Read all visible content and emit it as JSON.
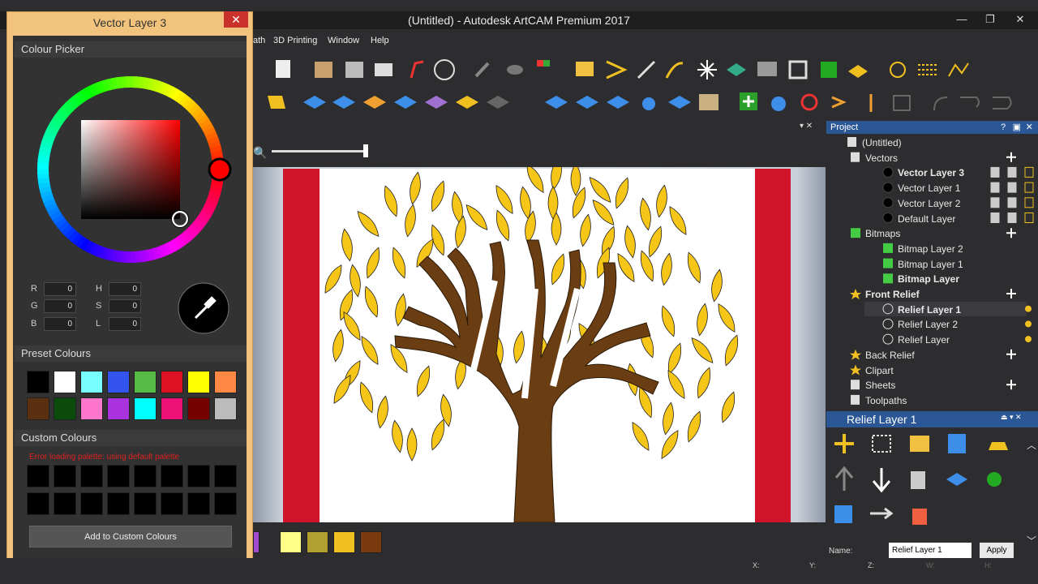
{
  "app": {
    "title": "(Untitled) - Autodesk ArtCAM Premium 2017",
    "minimize": "—",
    "restore": "❐",
    "close": "✕"
  },
  "menu": [
    "ath",
    "3D Printing",
    "Window",
    "Help"
  ],
  "dialog": {
    "title": "Vector Layer 3",
    "close": "✕",
    "picker_label": "Colour Picker",
    "fields": {
      "R": "0",
      "G": "0",
      "B": "0",
      "H": "0",
      "S": "0",
      "L": "0"
    },
    "labels": {
      "R": "R",
      "G": "G",
      "B": "B",
      "H": "H",
      "S": "S",
      "L": "L"
    },
    "preset_label": "Preset Colours",
    "preset_colors": [
      "#000000",
      "#ffffff",
      "#77ffff",
      "#3355ee",
      "#55bb44",
      "#dd1122",
      "#ffff00",
      "#ff8844",
      "#5a3010",
      "#0a4a0a",
      "#ff77cc",
      "#aa33dd",
      "#00ffff",
      "#ee1177",
      "#770000",
      "#bbbbbb"
    ],
    "custom_label": "Custom Colours",
    "error": "Error loading palette: using default palette",
    "add_button": "Add to Custom Colours"
  },
  "palette_colors": [
    "#a04ad0",
    "#ffff88",
    "#b0a030",
    "#f0c020",
    "#7a3a10"
  ],
  "project": {
    "header": "Project",
    "header_icons": "?  ▣ ✕",
    "items": [
      {
        "label": "(Untitled)",
        "bold": false
      },
      {
        "label": "Vectors",
        "bold": false
      },
      {
        "label": "Vector Layer 3",
        "bold": true
      },
      {
        "label": "Vector Layer 1",
        "bold": false
      },
      {
        "label": "Vector Layer 2",
        "bold": false
      },
      {
        "label": "Default Layer",
        "bold": false
      },
      {
        "label": "Bitmaps",
        "bold": false
      },
      {
        "label": "Bitmap Layer 2",
        "bold": false
      },
      {
        "label": "Bitmap Layer 1",
        "bold": false
      },
      {
        "label": "Bitmap Layer",
        "bold": true
      },
      {
        "label": "Front Relief",
        "bold": true
      },
      {
        "label": "Relief Layer 1",
        "bold": true
      },
      {
        "label": "Relief Layer 2",
        "bold": false
      },
      {
        "label": "Relief Layer",
        "bold": false
      },
      {
        "label": "Back Relief",
        "bold": false
      },
      {
        "label": "Clipart",
        "bold": false
      },
      {
        "label": "Sheets",
        "bold": false
      },
      {
        "label": "Toolpaths",
        "bold": false
      }
    ]
  },
  "relief_panel": {
    "title": "Relief Layer 1",
    "name_label": "Name:",
    "name_value": "Relief Layer 1",
    "apply": "Apply"
  },
  "status": {
    "x": "X:",
    "y": "Y:",
    "z": "Z:",
    "w": "W:",
    "h": "H:"
  },
  "colors": {
    "accent": "#2b5797",
    "dialog_border": "#f2c37c",
    "tree_red": "#d0142a",
    "leaf": "#f5c518",
    "trunk": "#6b3d12"
  }
}
